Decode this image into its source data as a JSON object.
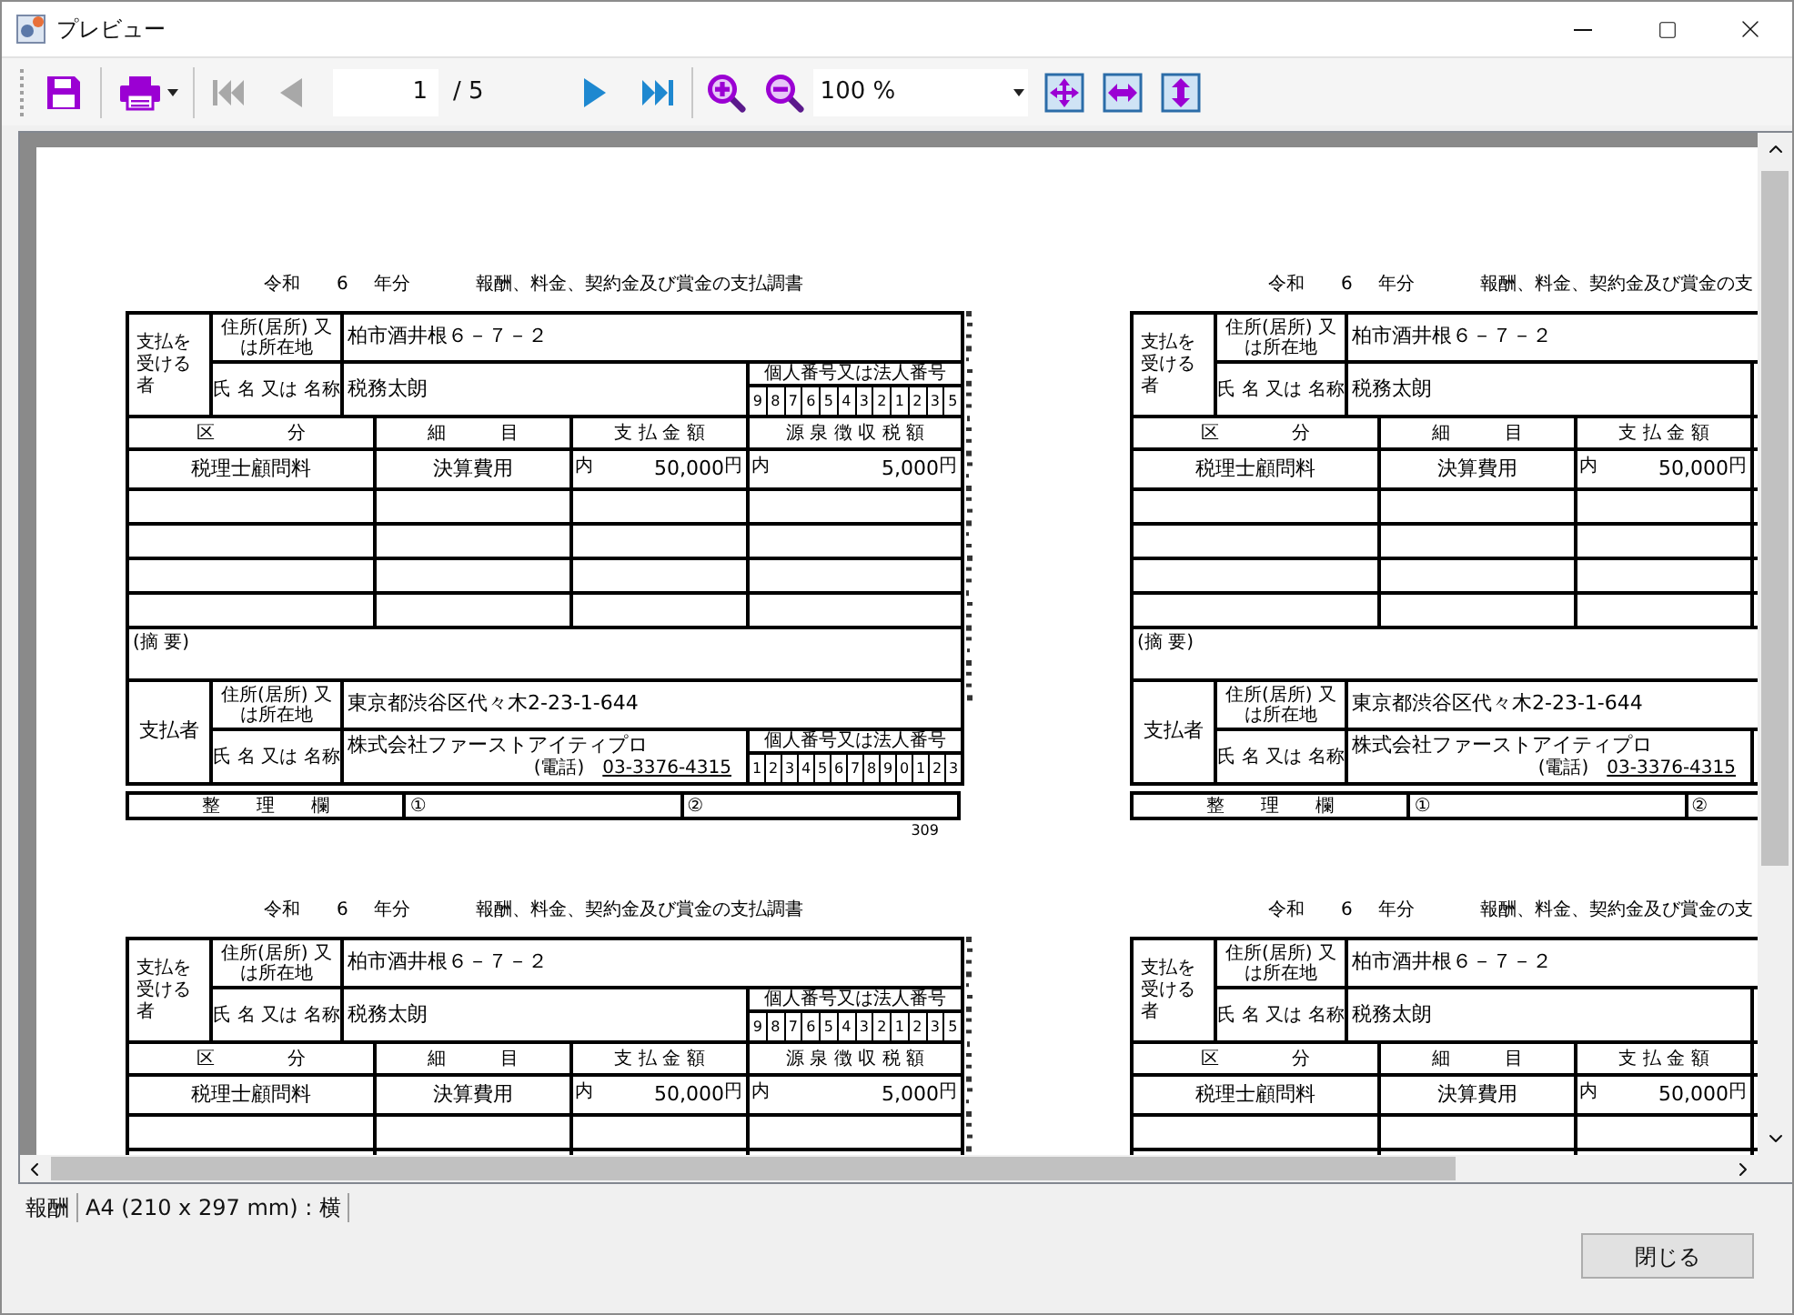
{
  "window": {
    "title": "プレビュー"
  },
  "toolbar": {
    "items": [
      {
        "kind": "save",
        "disabled": false
      },
      {
        "kind": "print",
        "disabled": false
      },
      {
        "kind": "first",
        "disabled": true
      },
      {
        "kind": "prev",
        "disabled": true
      },
      {
        "kind": "page",
        "value": "1",
        "total": "/ 5"
      },
      {
        "kind": "next",
        "disabled": false
      },
      {
        "kind": "last",
        "disabled": false
      },
      {
        "kind": "zoom_in"
      },
      {
        "kind": "zoom_out"
      },
      {
        "kind": "zoom",
        "value": "100 %"
      },
      {
        "kind": "fit_page"
      },
      {
        "kind": "fit_width"
      },
      {
        "kind": "fit_height"
      }
    ]
  },
  "pages": [
    {
      "title": {
        "era": "令和",
        "year": "6",
        "suffix": "年分",
        "text": "報酬、料金、契約金及び賞金の支払調書"
      },
      "payee": {
        "heading": "支払を受ける者",
        "address_label": "住所(居所) 又は所在地",
        "address": "柏市酒井根６－７－２",
        "name_label": "氏 名 又は 名称",
        "name": "税務太朗",
        "number_label": "個人番号又は法人番号",
        "number_digits": [
          "9",
          "8",
          "7",
          "6",
          "5",
          "4",
          "3",
          "2",
          "1",
          "2",
          "3",
          "5"
        ]
      },
      "columns": [
        "区　　　　分",
        "細　　　目",
        "支 払 金 額",
        "源 泉 徴 収 税 額"
      ],
      "rows": [
        {
          "category": "税理士顧問料",
          "detail": "決算費用",
          "payment_prefix": "内",
          "payment": "50,000",
          "payment_unit": "円",
          "tax_prefix": "内",
          "tax": "5,000",
          "tax_unit": "円"
        }
      ],
      "remarks_label": "(摘 要)",
      "payer": {
        "heading": "支払者",
        "address_label": "住所(居所) 又は所在地",
        "address": "東京都渋谷区代々木2-23-1-644",
        "name_label": "氏 名 又は 名称",
        "name": "株式会社ファーストアイティプロ",
        "phone_label": "(電話)",
        "phone": "03-3376-4315",
        "number_label": "個人番号又は法人番号",
        "number_digits": [
          "1",
          "2",
          "3",
          "4",
          "5",
          "6",
          "7",
          "8",
          "9",
          "0",
          "1",
          "2",
          "3"
        ]
      },
      "reference": {
        "label": "整　　理　　欄",
        "slot_1": "①",
        "slot_2": "②"
      },
      "page_code": "309"
    },
    {
      "title": {
        "era": "令和",
        "year": "6",
        "suffix": "年分",
        "text": "報酬、料金、契約金及び賞金の支"
      },
      "payee": {
        "heading": "支払を受ける者",
        "address_label": "住所(居所) 又は所在地",
        "address": "柏市酒井根６－７－２",
        "name_label": "氏 名 又は 名称",
        "name": "税務太朗"
      },
      "columns": [
        "区　　　　分",
        "細　　　目",
        "支 払 金 額"
      ],
      "rows": [
        {
          "category": "税理士顧問料",
          "detail": "決算費用",
          "payment_prefix": "内",
          "payment": "50,000",
          "payment_unit": "円"
        }
      ],
      "remarks_label": "(摘 要)",
      "payer": {
        "heading": "支払者",
        "address_label": "住所(居所) 又は所在地",
        "address": "東京都渋谷区代々木2-23-1-644",
        "name_label": "氏 名 又は 名称",
        "name": "株式会社ファーストアイティプロ",
        "phone_label": "(電話)",
        "phone": "03-3376-4315"
      },
      "reference": {
        "label": "整　　理　　欄",
        "slot_1": "①",
        "slot_2": "②"
      }
    },
    {
      "title": {
        "era": "令和",
        "year": "6",
        "suffix": "年分",
        "text": "報酬、料金、契約金及び賞金の支払調書"
      },
      "payee": {
        "heading": "支払を受ける者",
        "address_label": "住所(居所) 又は所在地",
        "address": "柏市酒井根６－７－２",
        "name_label": "氏 名 又は 名称",
        "name": "税務太朗",
        "number_label": "個人番号又は法人番号",
        "number_digits": [
          "9",
          "8",
          "7",
          "6",
          "5",
          "4",
          "3",
          "2",
          "1",
          "2",
          "3",
          "5"
        ]
      },
      "columns": [
        "区　　　　分",
        "細　　　目",
        "支 払 金 額",
        "源 泉 徴 収 税 額"
      ],
      "rows": [
        {
          "category": "税理士顧問料",
          "detail": "決算費用",
          "payment_prefix": "内",
          "payment": "50,000",
          "payment_unit": "円",
          "tax_prefix": "内",
          "tax": "5,000",
          "tax_unit": "円"
        }
      ]
    },
    {
      "title": {
        "era": "令和",
        "year": "6",
        "suffix": "年分",
        "text": "報酬、料金、契約金及び賞金の支"
      },
      "payee": {
        "heading": "支払を受ける者",
        "address_label": "住所(居所) 又は所在地",
        "address": "柏市酒井根６－７－２",
        "name_label": "氏 名 又は 名称",
        "name": "税務太朗"
      },
      "columns": [
        "区　　　　分",
        "細　　　目",
        "支 払 金 額"
      ],
      "rows": [
        {
          "category": "税理士顧問料",
          "detail": "決算費用",
          "payment_prefix": "内",
          "payment": "50,000",
          "payment_unit": "円"
        }
      ]
    }
  ],
  "status_bar": {
    "items": [
      "報酬",
      "A4 (210 x 297 mm) : 横"
    ]
  },
  "buttons": {
    "close": "閉じる"
  }
}
